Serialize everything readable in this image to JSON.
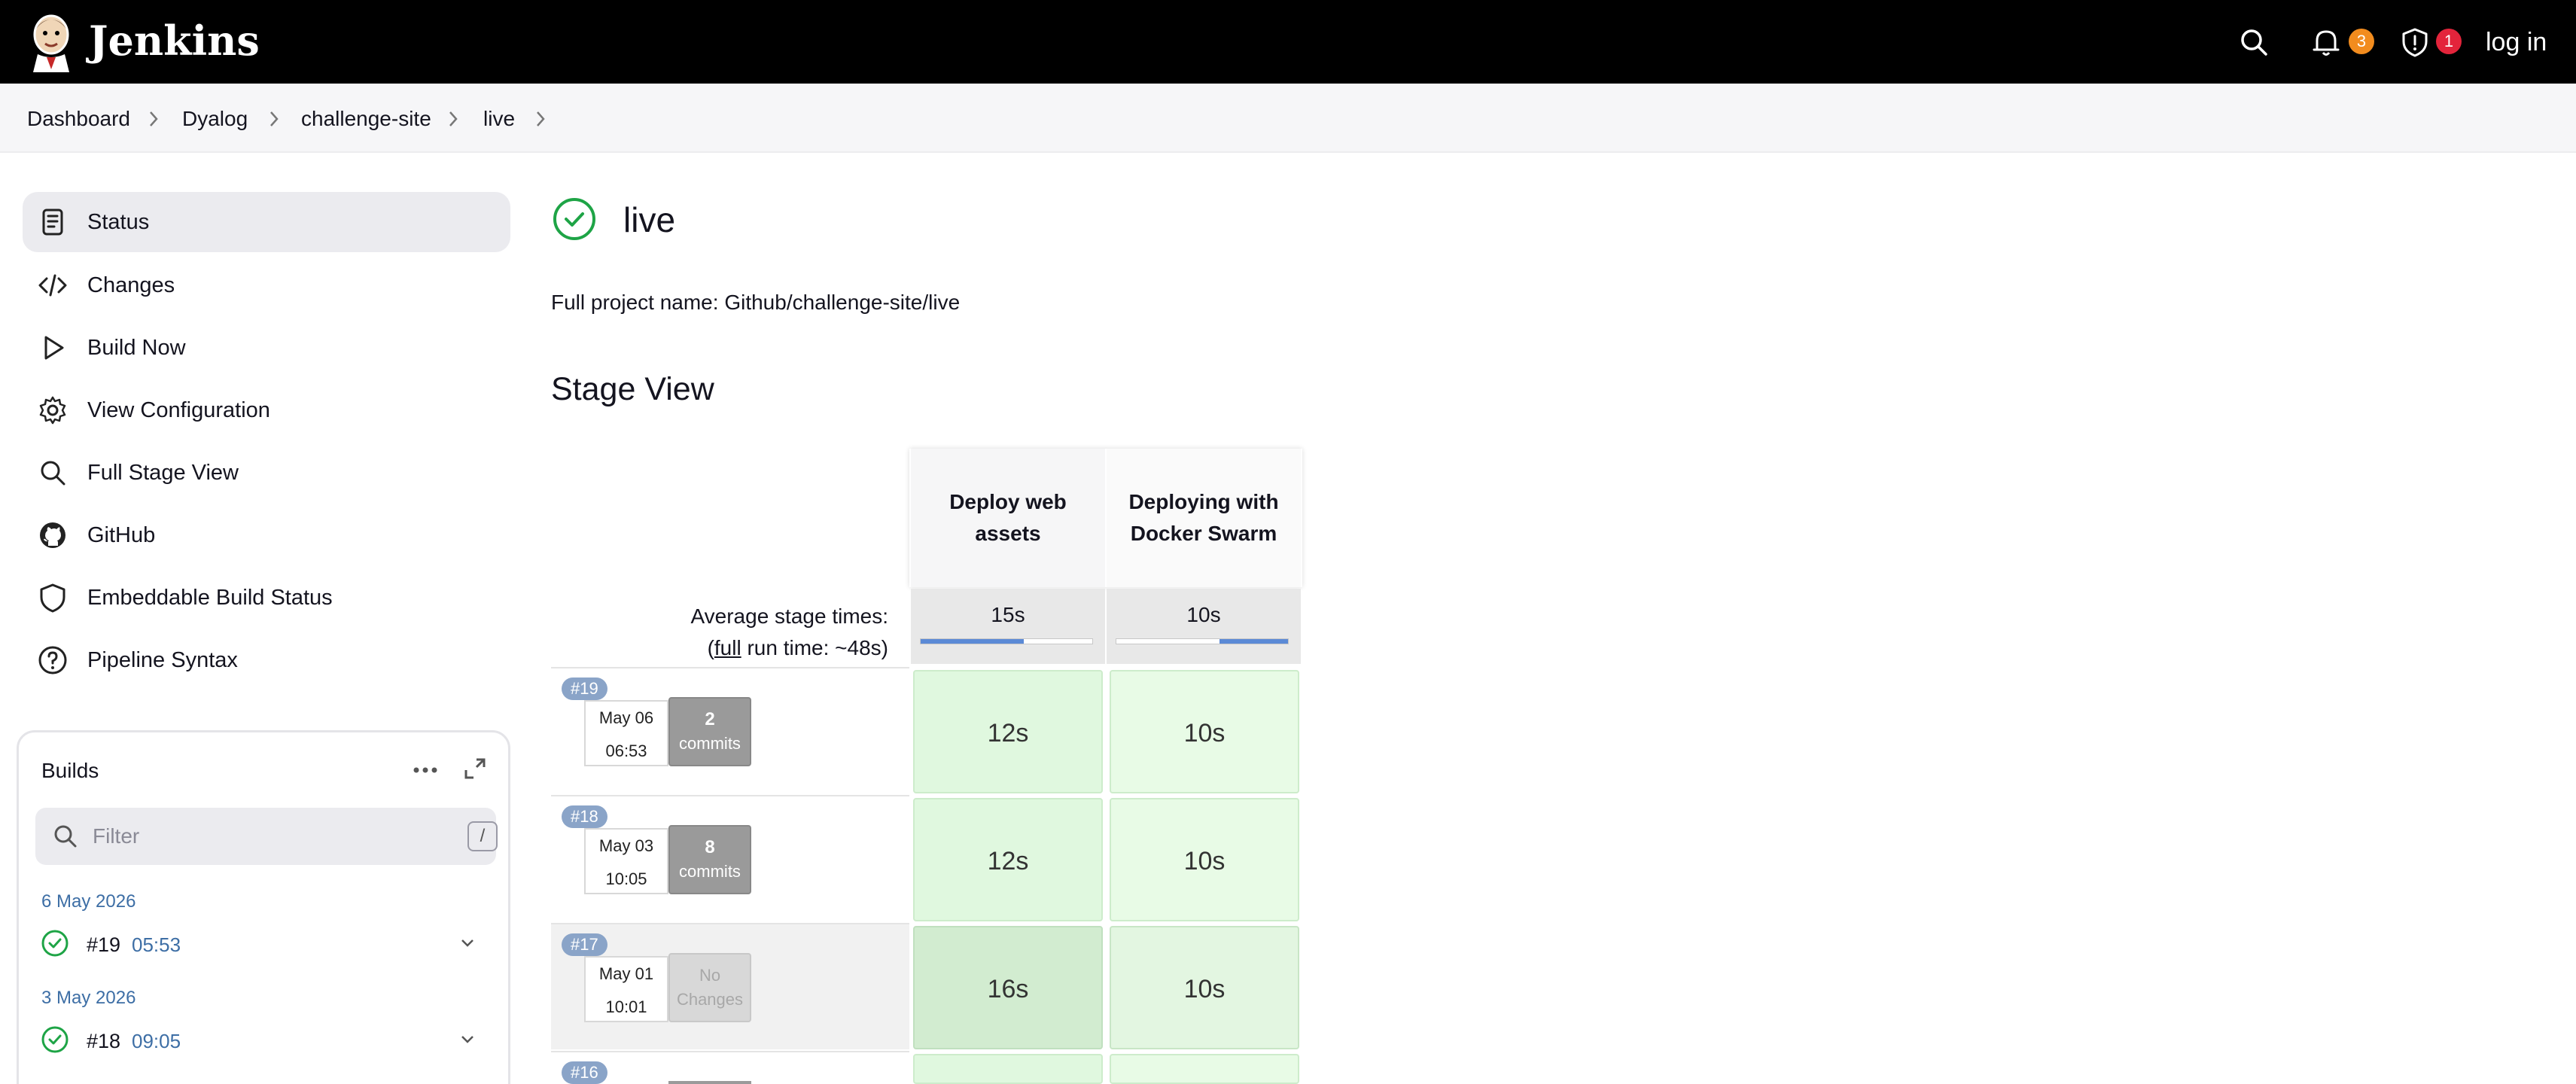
{
  "header": {
    "brand": "Jenkins",
    "notifications_count": "3",
    "security_count": "1",
    "login_label": "log in",
    "colors": {
      "notification_badge": "#f28c1e",
      "security_badge": "#e3243b"
    }
  },
  "breadcrumbs": [
    "Dashboard",
    "Dyalog",
    "challenge-site",
    "live"
  ],
  "sidebar": {
    "items": [
      {
        "label": "Status",
        "icon": "document-icon"
      },
      {
        "label": "Changes",
        "icon": "code-icon"
      },
      {
        "label": "Build Now",
        "icon": "play-icon"
      },
      {
        "label": "View Configuration",
        "icon": "gear-icon"
      },
      {
        "label": "Full Stage View",
        "icon": "search-icon"
      },
      {
        "label": "GitHub",
        "icon": "github-icon"
      },
      {
        "label": "Embeddable Build Status",
        "icon": "shield-icon"
      },
      {
        "label": "Pipeline Syntax",
        "icon": "help-icon"
      }
    ]
  },
  "builds": {
    "title": "Builds",
    "filter_placeholder": "Filter",
    "filter_shortcut": "/",
    "groups": [
      {
        "date": "6 May 2026",
        "number": "#19",
        "time": "05:53"
      },
      {
        "date": "3 May 2026",
        "number": "#18",
        "time": "09:05"
      }
    ]
  },
  "main": {
    "title": "live",
    "full_name": "Full project name: Github/challenge-site/live",
    "stage_view_title": "Stage View",
    "avg_label_line1": "Average stage times:",
    "avg_label_line2_prefix": "(",
    "avg_label_line2_link": "full",
    "avg_label_line2_suffix": " run time: ~48s)",
    "stages": [
      {
        "name": "Deploy web assets",
        "avg": "15s",
        "avg_fraction": 0.6
      },
      {
        "name": "Deploying with Docker Swarm",
        "avg": "10s",
        "avg_fraction": 0.4
      }
    ],
    "runs": [
      {
        "badge": "#19",
        "date": "May 06",
        "time": "06:53",
        "commits_count": "2",
        "commits_label": "commits",
        "durations": [
          "12s",
          "10s"
        ]
      },
      {
        "badge": "#18",
        "date": "May 03",
        "time": "10:05",
        "commits_count": "8",
        "commits_label": "commits",
        "durations": [
          "12s",
          "10s"
        ]
      },
      {
        "badge": "#17",
        "date": "May 01",
        "time": "10:01",
        "commits_count": "No",
        "commits_label": "Changes",
        "durations": [
          "16s",
          "10s"
        ]
      },
      {
        "badge": "#16"
      }
    ]
  }
}
